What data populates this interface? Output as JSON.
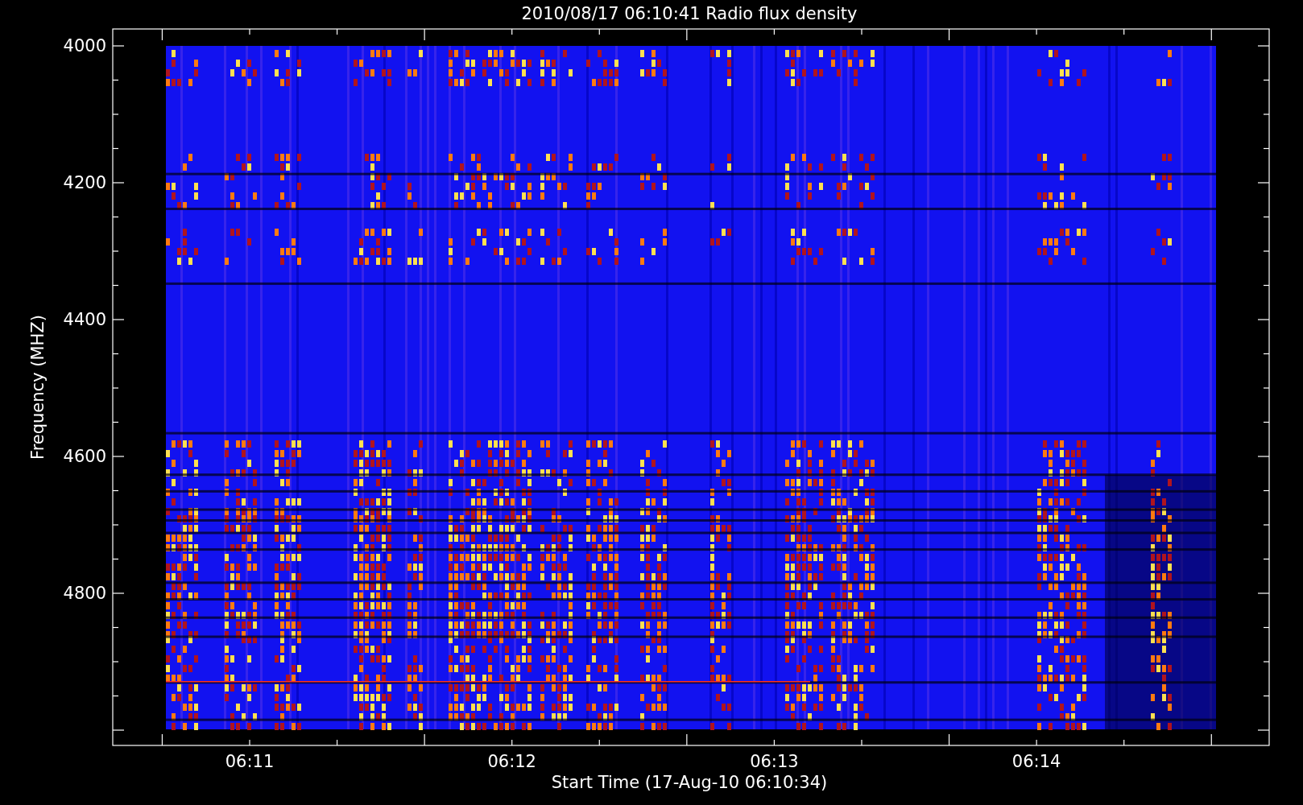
{
  "title": "2010/08/17 06:10:41 Radio flux density",
  "y_axis": {
    "label": "Frequency (MHZ)",
    "ticks": [
      "4000",
      "4200",
      "4400",
      "4600",
      "4800"
    ]
  },
  "x_axis": {
    "label": "Start Time (17-Aug-10 06:10:34)",
    "ticks": [
      "06:11",
      "06:12",
      "06:13",
      "06:14"
    ]
  }
}
